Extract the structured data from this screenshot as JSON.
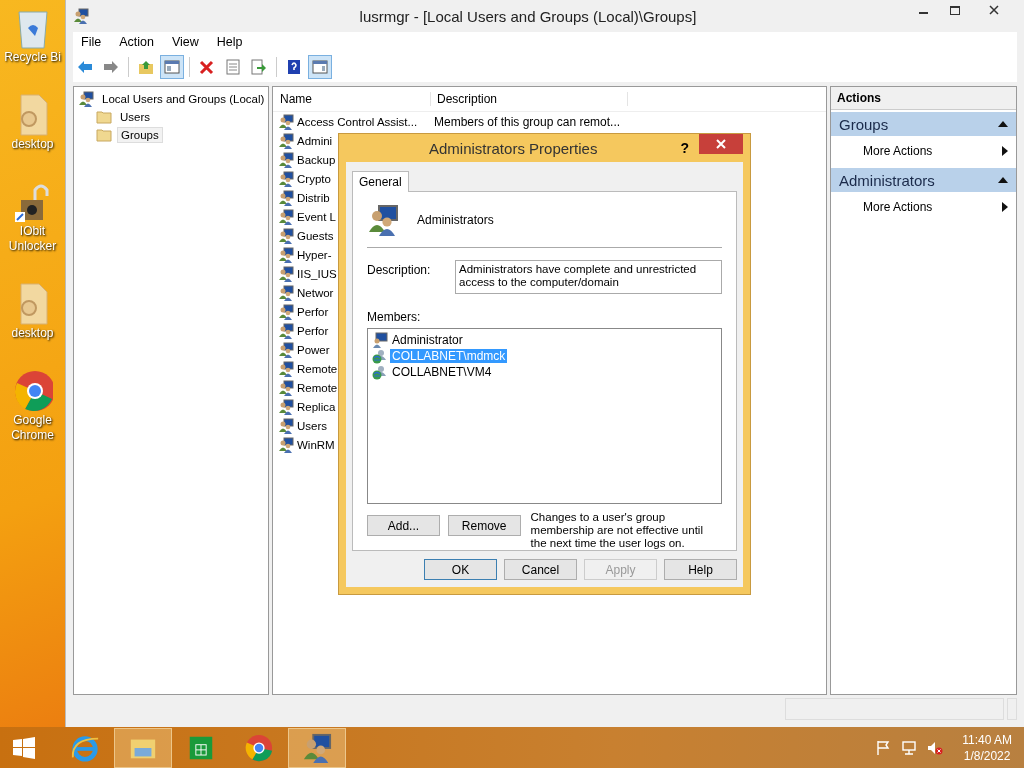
{
  "desktop_icons": [
    {
      "label": "Recycle Bi",
      "kind": "recycle"
    },
    {
      "label": "desktop",
      "kind": "file"
    },
    {
      "label": "IObit Unlocker",
      "kind": "lock"
    },
    {
      "label": "desktop",
      "kind": "file"
    },
    {
      "label": "Google Chrome",
      "kind": "chrome"
    }
  ],
  "window": {
    "title": "lusrmgr - [Local Users and Groups (Local)\\Groups]",
    "menu": [
      "File",
      "Action",
      "View",
      "Help"
    ],
    "toolbar": [
      {
        "kind": "back",
        "pressed": false
      },
      {
        "kind": "forward",
        "pressed": false
      },
      {
        "kind": "sep"
      },
      {
        "kind": "up",
        "pressed": false
      },
      {
        "kind": "tree",
        "pressed": true
      },
      {
        "kind": "sep"
      },
      {
        "kind": "delete",
        "pressed": false
      },
      {
        "kind": "properties",
        "pressed": false
      },
      {
        "kind": "export",
        "pressed": false
      },
      {
        "kind": "sep"
      },
      {
        "kind": "help",
        "pressed": false
      },
      {
        "kind": "pane",
        "pressed": true
      }
    ]
  },
  "tree": {
    "label": "Local Users and Groups (Local)",
    "children": [
      {
        "label": "Users",
        "selected": false
      },
      {
        "label": "Groups",
        "selected": true
      }
    ]
  },
  "list": {
    "columns": [
      "Name",
      "Description"
    ],
    "rows": [
      {
        "name": "Access Control Assist...",
        "description": "Members of this group can remot..."
      },
      {
        "name": "Admini"
      },
      {
        "name": "Backup"
      },
      {
        "name": "Crypto"
      },
      {
        "name": "Distrib"
      },
      {
        "name": "Event L"
      },
      {
        "name": "Guests"
      },
      {
        "name": "Hyper-"
      },
      {
        "name": "IIS_IUS"
      },
      {
        "name": "Networ"
      },
      {
        "name": "Perfor"
      },
      {
        "name": "Perfor"
      },
      {
        "name": "Power"
      },
      {
        "name": "Remote"
      },
      {
        "name": "Remote"
      },
      {
        "name": "Replica"
      },
      {
        "name": "Users"
      },
      {
        "name": "WinRM"
      }
    ]
  },
  "actions": {
    "title": "Actions",
    "sections": [
      {
        "title": "Groups",
        "items": [
          "More Actions"
        ]
      },
      {
        "title": "Administrators",
        "items": [
          "More Actions"
        ]
      }
    ]
  },
  "dialog": {
    "title": "Administrators Properties",
    "help": "?",
    "tabs": [
      {
        "label": "General",
        "selected": true
      }
    ],
    "group_name": "Administrators",
    "description_label": "Description:",
    "description": "Administrators have complete and unrestricted access to the computer/domain",
    "members_label": "Members:",
    "members": [
      {
        "name": "Administrator",
        "kind": "user",
        "selected": false
      },
      {
        "name": "COLLABNET\\mdmck",
        "kind": "domain",
        "selected": true
      },
      {
        "name": "COLLABNET\\VM4",
        "kind": "domain",
        "selected": false
      }
    ],
    "member_buttons": [
      "Add...",
      "Remove"
    ],
    "note": "Changes to a user's group membership are not effective until the next time the user logs on.",
    "buttons": [
      {
        "label": "OK",
        "default": true,
        "disabled": false
      },
      {
        "label": "Cancel",
        "default": false,
        "disabled": false
      },
      {
        "label": "Apply",
        "default": false,
        "disabled": true
      },
      {
        "label": "Help",
        "default": false,
        "disabled": false
      }
    ]
  },
  "taskbar": {
    "items": [
      {
        "kind": "ie",
        "active": false
      },
      {
        "kind": "explorer",
        "active": true
      },
      {
        "kind": "store",
        "active": false
      },
      {
        "kind": "chrome",
        "active": false
      },
      {
        "kind": "users",
        "active": true
      }
    ],
    "time": "11:40 AM",
    "date": "1/8/2022"
  }
}
